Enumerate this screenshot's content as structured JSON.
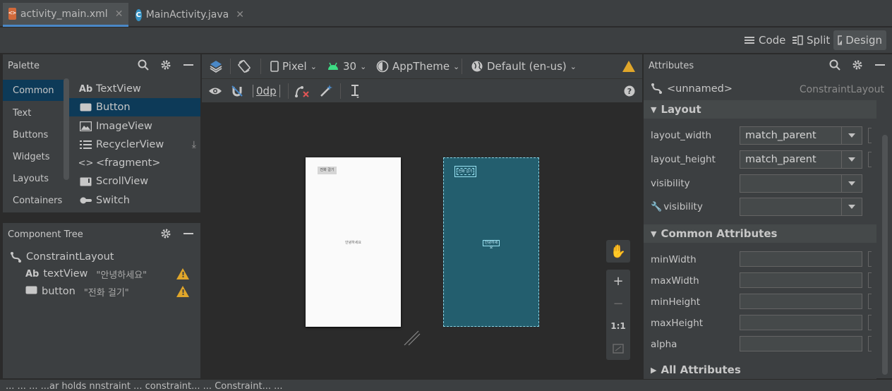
{
  "tabs": [
    {
      "label": "activity_main.xml",
      "icon": "xml-layout-icon",
      "active": true
    },
    {
      "label": "MainActivity.java",
      "icon": "java-class-icon",
      "active": false
    }
  ],
  "view_modes": {
    "code": "Code",
    "split": "Split",
    "design": "Design",
    "active": "Design"
  },
  "palette": {
    "title": "Palette",
    "categories": [
      "Common",
      "Text",
      "Buttons",
      "Widgets",
      "Layouts",
      "Containers"
    ],
    "selected_category": "Common",
    "items": [
      {
        "label": "TextView",
        "icon": "textview-icon"
      },
      {
        "label": "Button",
        "icon": "button-icon"
      },
      {
        "label": "ImageView",
        "icon": "image-icon"
      },
      {
        "label": "RecyclerView",
        "icon": "list-icon"
      },
      {
        "label": "<fragment>",
        "icon": "code-brackets-icon"
      },
      {
        "label": "ScrollView",
        "icon": "scrollview-icon"
      },
      {
        "label": "Switch",
        "icon": "switch-icon"
      }
    ],
    "selected_item": "Button"
  },
  "component_tree": {
    "title": "Component Tree",
    "root": "ConstraintLayout",
    "children": [
      {
        "name": "textView",
        "text": "\"안녕하세요\"",
        "icon": "textview-icon",
        "warning": true
      },
      {
        "name": "button",
        "text": "\"전화 걸기\"",
        "icon": "button-icon",
        "warning": true
      }
    ]
  },
  "design_toolbar": {
    "device": "Pixel",
    "api": "30",
    "theme": "AppTheme",
    "locale": "Default (en-us)",
    "margin": "0dp"
  },
  "canvas": {
    "preview_button_text": "전화 걸기",
    "preview_text": "안녕하세요",
    "zoom_actual": "1:1"
  },
  "attributes": {
    "title": "Attributes",
    "component_id": "<unnamed>",
    "component_type": "ConstraintLayout",
    "layout_section": "Layout",
    "layout_width_label": "layout_width",
    "layout_width_value": "match_parent",
    "layout_height_label": "layout_height",
    "layout_height_value": "match_parent",
    "visibility_label": "visibility",
    "tools_visibility_label": "visibility",
    "common_section": "Common Attributes",
    "common_fields": [
      "minWidth",
      "maxWidth",
      "minHeight",
      "maxHeight",
      "alpha"
    ],
    "all_section": "All Attributes"
  },
  "status": "... ... ... ...ar holds nnstraint ... constraint... ... Constraint... ..."
}
